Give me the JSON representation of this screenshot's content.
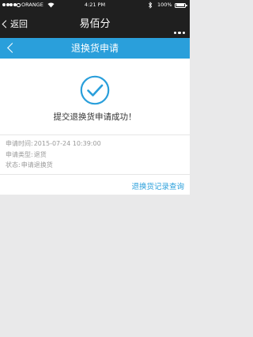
{
  "status_bar": {
    "carrier": "ORANGE",
    "time": "4:21 PM",
    "battery": "100%"
  },
  "wechat_bar": {
    "back_label": "返回",
    "title": "易佰分"
  },
  "app_bar": {
    "title": "退换货申请"
  },
  "result": {
    "message": "提交退换货申请成功！"
  },
  "details": [
    {
      "label": "申请时间:",
      "value": "2015-07-24 10:39:00"
    },
    {
      "label": "申请类型:",
      "value": "退货"
    },
    {
      "label": "状态:",
      "value": "申请退换货"
    }
  ],
  "history_link": "退换货记录查询",
  "colors": {
    "accent": "#2a9fdb",
    "dark_bar": "#1f1f1f",
    "background": "#e9e9ea"
  }
}
